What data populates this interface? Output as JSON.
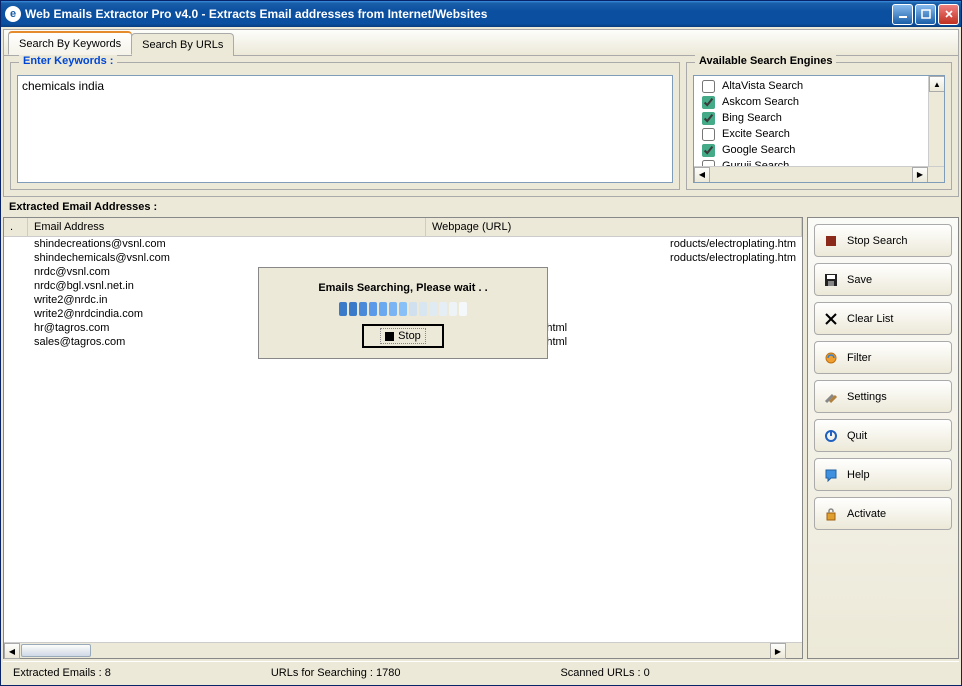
{
  "title": "Web Emails Extractor Pro v4.0 - Extracts Email addresses from Internet/Websites",
  "tabs": {
    "keywords": "Search By Keywords",
    "urls": "Search By URLs"
  },
  "keywords_group_title": "Enter Keywords :",
  "keywords_value": "chemicals india",
  "engines_title": "Available Search Engines",
  "engines": [
    {
      "label": "AltaVista Search",
      "checked": false
    },
    {
      "label": "Askcom Search",
      "checked": true
    },
    {
      "label": "Bing Search",
      "checked": true
    },
    {
      "label": "Excite Search",
      "checked": false
    },
    {
      "label": "Google Search",
      "checked": true
    },
    {
      "label": "Guruji Search",
      "checked": false
    }
  ],
  "extracted_label": "Extracted Email Addresses :",
  "columns": {
    "sno": ".",
    "email": "Email Address",
    "url": "Webpage (URL)"
  },
  "rows": [
    {
      "email": "sales@tagros.com",
      "url": "http://tagros.com/index.html"
    },
    {
      "email": "hr@tagros.com",
      "url": "http://tagros.com/index.html"
    },
    {
      "email": "write2@nrdcindia.com",
      "url": ""
    },
    {
      "email": "write2@nrdc.in",
      "url": ""
    },
    {
      "email": "nrdc@bgl.vsnl.net.in",
      "url": ""
    },
    {
      "email": "nrdc@vsnl.com",
      "url": ""
    },
    {
      "email": "shindechemicals@vsnl.com",
      "url": "roducts/electroplating.htm"
    },
    {
      "email": "shindecreations@vsnl.com",
      "url": "roducts/electroplating.htm"
    }
  ],
  "modal": {
    "text": "Emails Searching, Please wait . .",
    "stop": "Stop"
  },
  "side": {
    "stop_search": "Stop Search",
    "save": "Save",
    "clear_list": "Clear List",
    "filter": "Filter",
    "settings": "Settings",
    "quit": "Quit",
    "help": "Help",
    "activate": "Activate"
  },
  "status": {
    "extracted": "Extracted Emails :  8",
    "urls_for_search": "URLs for Searching :   1780",
    "scanned": "Scanned URLs :  0"
  }
}
